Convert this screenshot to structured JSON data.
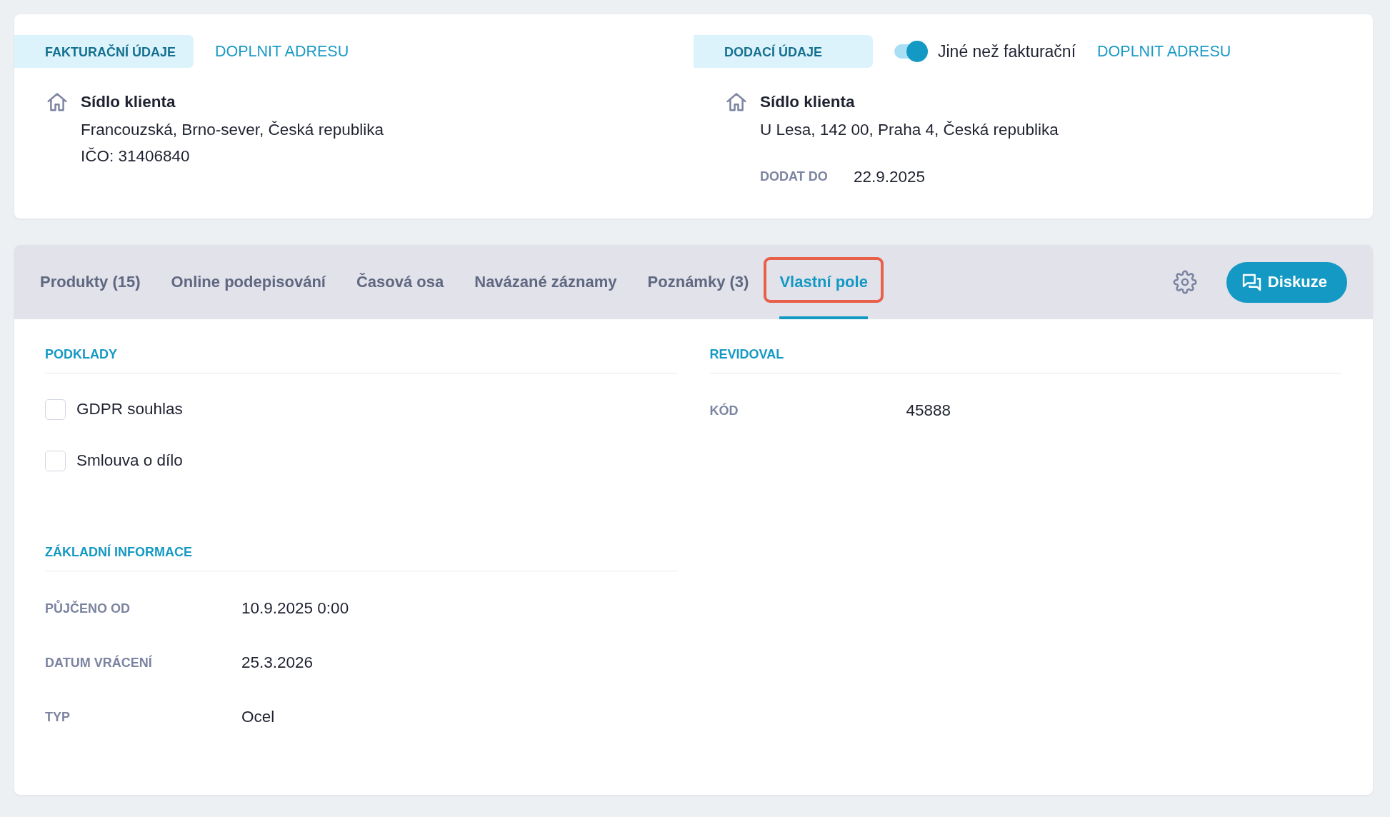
{
  "billing": {
    "heading": "FAKTURAČNÍ ÚDAJE",
    "action": "DOPLNIT ADRESU",
    "address": {
      "title": "Sídlo klienta",
      "lines": [
        "Francouzská, Brno-sever, Česká republika",
        "IČO: 31406840"
      ]
    }
  },
  "shipping": {
    "heading": "DODACÍ ÚDAJE",
    "toggle": {
      "label": "Jiné než fakturační",
      "on": true
    },
    "action": "DOPLNIT ADRESU",
    "address": {
      "title": "Sídlo klienta",
      "lines": [
        "U Lesa, 142 00, Praha 4, Česká republika"
      ]
    },
    "fields": [
      {
        "label": "DODAT DO",
        "value": "22.9.2025"
      }
    ]
  },
  "tabs": [
    {
      "label": "Produkty (15)",
      "selected": false,
      "highlighted": false
    },
    {
      "label": "Online podepisování",
      "selected": false,
      "highlighted": false
    },
    {
      "label": "Časová osa",
      "selected": false,
      "highlighted": false
    },
    {
      "label": "Navázané záznamy",
      "selected": false,
      "highlighted": false
    },
    {
      "label": "Poznámky (3)",
      "selected": false,
      "highlighted": false
    },
    {
      "label": "Vlastní pole",
      "selected": true,
      "highlighted": true
    }
  ],
  "toolbar": {
    "discuss_button": "Diskuze"
  },
  "columns": [
    {
      "sections": [
        {
          "title": "PODKLADY",
          "items": [
            {
              "kind": "checkbox",
              "label": "GDPR souhlas",
              "checked": false
            },
            {
              "kind": "checkbox",
              "label": "Smlouva o dílo",
              "checked": false
            }
          ]
        },
        {
          "title": "ZÁKLADNÍ INFORMACE",
          "items": [
            {
              "kind": "field",
              "label": "PŮJČENO OD",
              "value": "10.9.2025 0:00"
            },
            {
              "kind": "field",
              "label": "DATUM VRÁCENÍ",
              "value": "25.3.2026"
            },
            {
              "kind": "field",
              "label": "TYP",
              "value": "Ocel"
            }
          ]
        }
      ]
    },
    {
      "sections": [
        {
          "title": "REVIDOVAL",
          "items": [
            {
              "kind": "field",
              "label": "KÓD",
              "value": "45888"
            }
          ]
        }
      ]
    }
  ]
}
